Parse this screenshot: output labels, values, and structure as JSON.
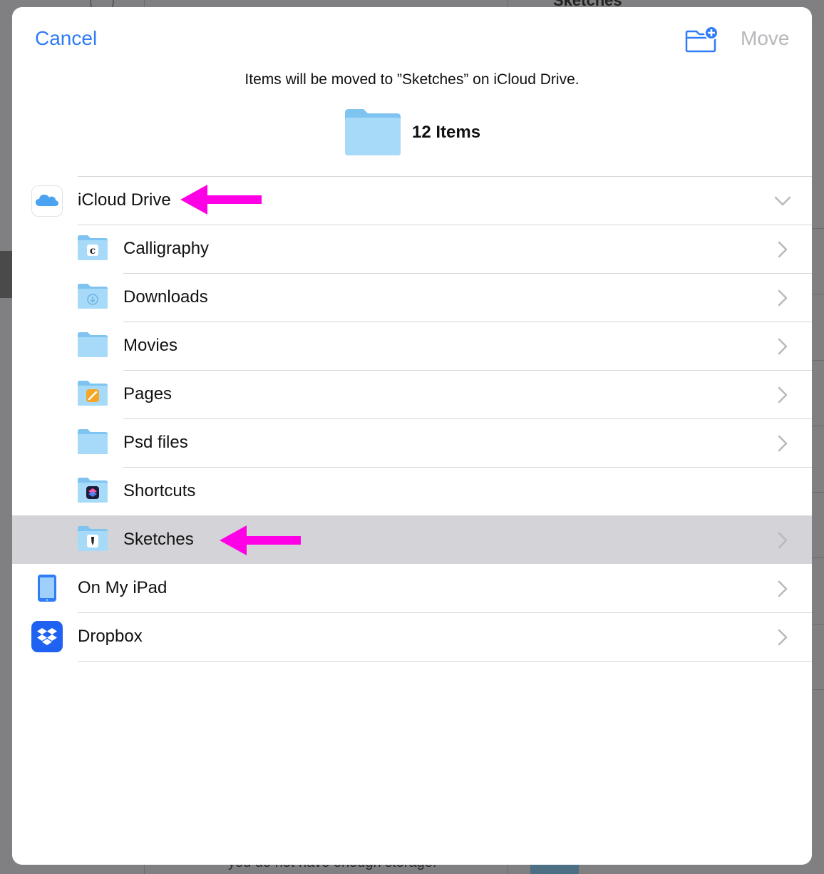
{
  "header": {
    "cancel_label": "Cancel",
    "move_label": "Move",
    "new_folder_icon": "folder-badge-plus-icon"
  },
  "destination": {
    "message": "Items will be moved to ”Sketches” on iCloud Drive.",
    "items_count": "12 Items"
  },
  "locations": {
    "icloud": {
      "label": "iCloud Drive",
      "icon": "icloud-icon",
      "expanded": true
    },
    "folders": [
      {
        "label": "Calligraphy",
        "icon": "calligraphy-folder-icon",
        "chevron": true
      },
      {
        "label": "Downloads",
        "icon": "downloads-folder-icon",
        "chevron": true
      },
      {
        "label": "Movies",
        "icon": "folder-icon",
        "chevron": true
      },
      {
        "label": "Pages",
        "icon": "pages-folder-icon",
        "chevron": true
      },
      {
        "label": "Psd files",
        "icon": "folder-icon",
        "chevron": true
      },
      {
        "label": "Shortcuts",
        "icon": "shortcuts-folder-icon",
        "chevron": false
      },
      {
        "label": "Sketches",
        "icon": "sketches-folder-icon",
        "chevron": true,
        "selected": true
      }
    ],
    "on_my_ipad": {
      "label": "On My iPad",
      "icon": "ipad-icon"
    },
    "dropbox": {
      "label": "Dropbox",
      "icon": "dropbox-icon"
    }
  },
  "background": {
    "footnote": "you do not have enough storage."
  },
  "colors": {
    "accent": "#2f7cf6",
    "disabled": "#b8b8bc",
    "folder": "#8fcdf3",
    "selected_row": "#d3d3d8",
    "annotation_arrow": "#ff00e6"
  }
}
